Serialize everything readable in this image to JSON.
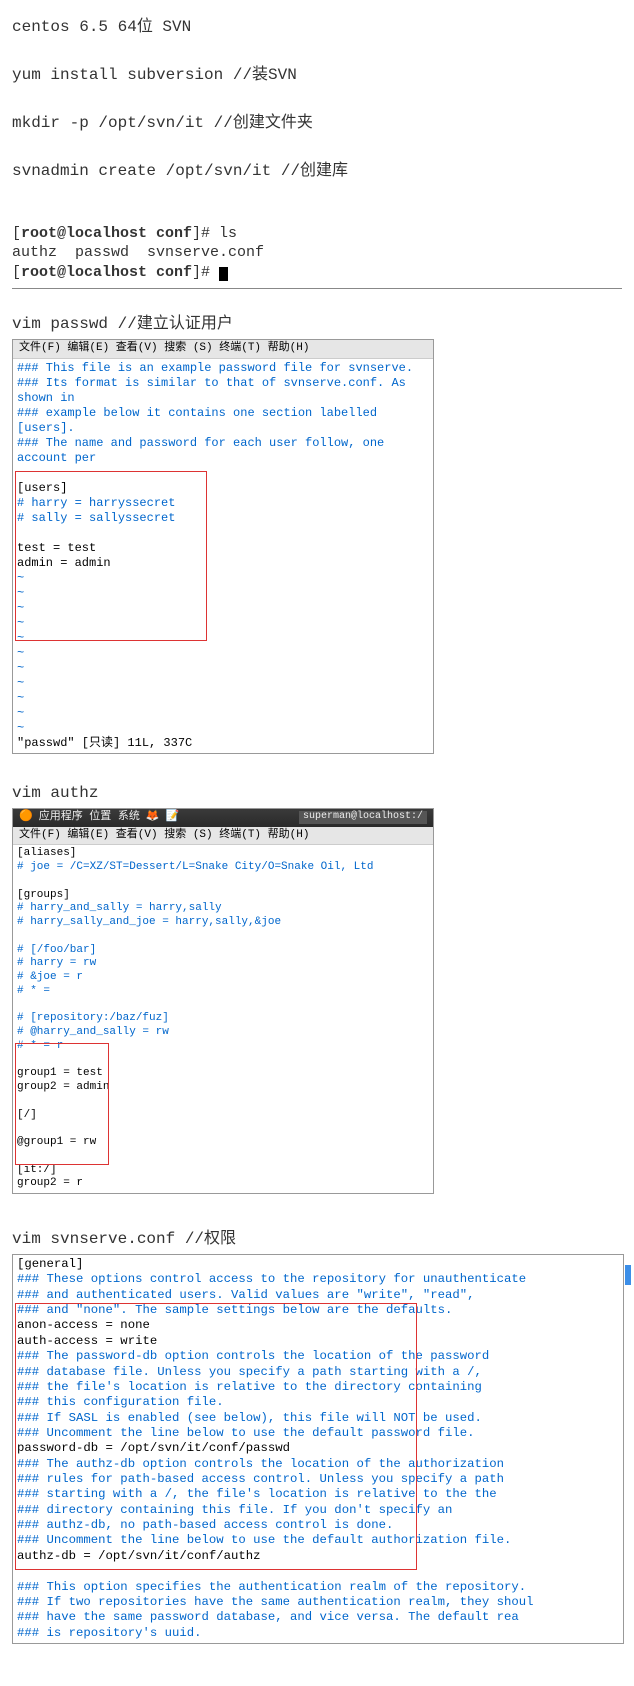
{
  "heading": "centos 6.5 64位  SVN",
  "cmd_install": "yum install subversion //装SVN",
  "cmd_mkdir": "mkdir -p /opt/svn/it //创建文件夹",
  "cmd_svnadmin": "svnadmin create /opt/svn/it //创建库",
  "terminal": {
    "l1_a": "[",
    "l1_b": "root@localhost conf",
    "l1_c": "]# ls",
    "l2": "authz  passwd  svnserve.conf",
    "l3_a": "[",
    "l3_b": "root@localhost conf",
    "l3_c": "]# "
  },
  "passwd": {
    "title": "vim passwd //建立认证用户",
    "menubar": "文件(F)  编辑(E)  查看(V)  搜索 (S)  终端(T)  帮助(H)",
    "lines": [
      {
        "c": "cm",
        "t": "### This file is an example password file for svnserve."
      },
      {
        "c": "cm",
        "t": "### Its format is similar to that of svnserve.conf. As shown in"
      },
      {
        "c": "cm",
        "t": "### example below it contains one section labelled [users]."
      },
      {
        "c": "cm",
        "t": "### The name and password for each user follow, one account per"
      },
      {
        "c": "blk",
        "t": ""
      },
      {
        "c": "blk",
        "t": "[users]"
      },
      {
        "c": "cm",
        "t": "# harry = harryssecret"
      },
      {
        "c": "cm",
        "t": "# sally = sallyssecret"
      },
      {
        "c": "blk",
        "t": ""
      },
      {
        "c": "blk",
        "t": "test = test"
      },
      {
        "c": "blk",
        "t": "admin = admin"
      },
      {
        "c": "cm",
        "t": "~"
      },
      {
        "c": "cm",
        "t": "~"
      },
      {
        "c": "cm",
        "t": "~"
      },
      {
        "c": "cm",
        "t": "~"
      },
      {
        "c": "cm",
        "t": "~"
      },
      {
        "c": "cm",
        "t": "~"
      },
      {
        "c": "cm",
        "t": "~"
      },
      {
        "c": "cm",
        "t": "~"
      },
      {
        "c": "cm",
        "t": "~"
      },
      {
        "c": "cm",
        "t": "~"
      },
      {
        "c": "cm",
        "t": "~"
      },
      {
        "c": "blk",
        "t": "\"passwd\"  [只读]  11L,  337C"
      }
    ]
  },
  "authz": {
    "title": "vim authz",
    "topbar_items": "应用程序  位置  系统",
    "tag": "superman@localhost:/",
    "menubar": "文件(F)  编辑(E)  查看(V)  搜索 (S)  终端(T)  帮助(H)",
    "lines": [
      {
        "c": "blk",
        "t": "[aliases]"
      },
      {
        "c": "cm",
        "t": "# joe = /C=XZ/ST=Dessert/L=Snake City/O=Snake Oil, Ltd"
      },
      {
        "c": "blk",
        "t": ""
      },
      {
        "c": "blk",
        "t": "[groups]"
      },
      {
        "c": "cm",
        "t": "# harry_and_sally = harry,sally"
      },
      {
        "c": "cm",
        "t": "# harry_sally_and_joe = harry,sally,&joe"
      },
      {
        "c": "blk",
        "t": ""
      },
      {
        "c": "cm",
        "t": "# [/foo/bar]"
      },
      {
        "c": "cm",
        "t": "# harry = rw"
      },
      {
        "c": "cm",
        "t": "# &joe = r"
      },
      {
        "c": "cm",
        "t": "# * ="
      },
      {
        "c": "blk",
        "t": ""
      },
      {
        "c": "cm",
        "t": "# [repository:/baz/fuz]"
      },
      {
        "c": "cm",
        "t": "# @harry_and_sally = rw"
      },
      {
        "c": "cm",
        "t": "# * = r"
      },
      {
        "c": "blk",
        "t": ""
      },
      {
        "c": "blk",
        "t": "group1 = test"
      },
      {
        "c": "blk",
        "t": "group2 = admin"
      },
      {
        "c": "blk",
        "t": ""
      },
      {
        "c": "blk",
        "t": "[/]"
      },
      {
        "c": "blk",
        "t": ""
      },
      {
        "c": "blk",
        "t": "@group1 = rw"
      },
      {
        "c": "blk",
        "t": ""
      },
      {
        "c": "blk",
        "t": "[it:/]"
      },
      {
        "c": "blk",
        "t": "group2 = r"
      }
    ]
  },
  "svnserve": {
    "title": "vim svnserve.conf //权限",
    "lines": [
      {
        "c": "blk",
        "t": "[general]"
      },
      {
        "c": "cm",
        "t": "### These options control access to the repository for unauthenticate"
      },
      {
        "c": "cm",
        "t": "### and authenticated users.  Valid values are \"write\", \"read\","
      },
      {
        "c": "cm",
        "t": "### and \"none\".  The sample settings below are the defaults."
      },
      {
        "c": "blk",
        "t": "anon-access = none"
      },
      {
        "c": "blk",
        "t": "auth-access = write"
      },
      {
        "c": "cm",
        "t": "### The password-db option controls the location of the password"
      },
      {
        "c": "cm",
        "t": "### database file.  Unless you specify a path starting with a /,"
      },
      {
        "c": "cm",
        "t": "### the file's location is relative to the directory containing"
      },
      {
        "c": "cm",
        "t": "### this configuration file."
      },
      {
        "c": "cm",
        "t": "### If SASL is enabled (see below), this file will NOT be used."
      },
      {
        "c": "cm",
        "t": "### Uncomment the line below to use the default password file."
      },
      {
        "c": "blk",
        "t": "password-db = /opt/svn/it/conf/passwd"
      },
      {
        "c": "cm",
        "t": "### The authz-db option controls the location of the authorization"
      },
      {
        "c": "cm",
        "t": "### rules for path-based access control.  Unless you specify a path"
      },
      {
        "c": "cm",
        "t": "### starting with a /, the file's location is relative to the the"
      },
      {
        "c": "cm",
        "t": "### directory containing this file.  If you don't specify an"
      },
      {
        "c": "cm",
        "t": "### authz-db, no path-based access control is done."
      },
      {
        "c": "cm",
        "t": "### Uncomment the line below to use the default authorization file."
      },
      {
        "c": "blk",
        "t": "authz-db = /opt/svn/it/conf/authz"
      },
      {
        "c": "blk",
        "t": ""
      },
      {
        "c": "cm",
        "t": "### This option specifies the authentication realm of the repository."
      },
      {
        "c": "cm",
        "t": "### If two repositories have the same authentication realm, they shoul"
      },
      {
        "c": "cm",
        "t": "### have the same password database, and vice versa.  The default rea"
      },
      {
        "c": "cm",
        "t": "### is repository's uuid."
      }
    ]
  }
}
